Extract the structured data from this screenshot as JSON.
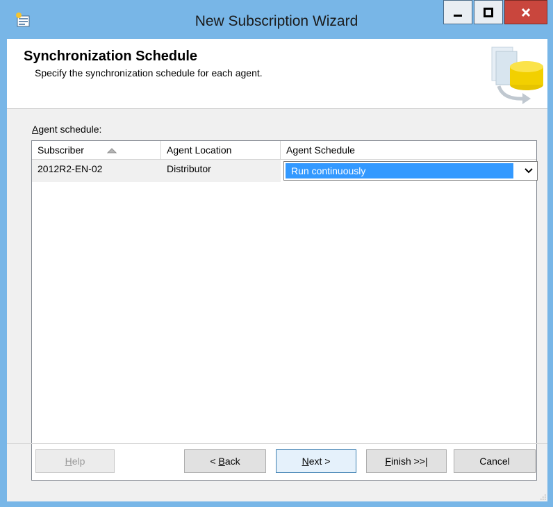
{
  "window": {
    "title": "New Subscription Wizard"
  },
  "header": {
    "title": "Synchronization Schedule",
    "subtitle": "Specify the synchronization schedule for each agent."
  },
  "schedule": {
    "label_underline": "A",
    "label_rest": "gent schedule:",
    "columns": [
      "Subscriber",
      "Agent Location",
      "Agent Schedule"
    ],
    "rows": [
      {
        "subscriber": "2012R2-EN-02",
        "location": "Distributor",
        "schedule": "Run continuously"
      }
    ]
  },
  "buttons": {
    "help_u": "H",
    "help_rest": "elp",
    "back_pre": "< ",
    "back_u": "B",
    "back_rest": "ack",
    "next_u": "N",
    "next_rest": "ext >",
    "finish_u": "F",
    "finish_rest": "inish >>|",
    "cancel": "Cancel"
  },
  "colors": {
    "titlebar": "#78b6e7",
    "selection": "#3399ff",
    "close": "#c9463d"
  }
}
